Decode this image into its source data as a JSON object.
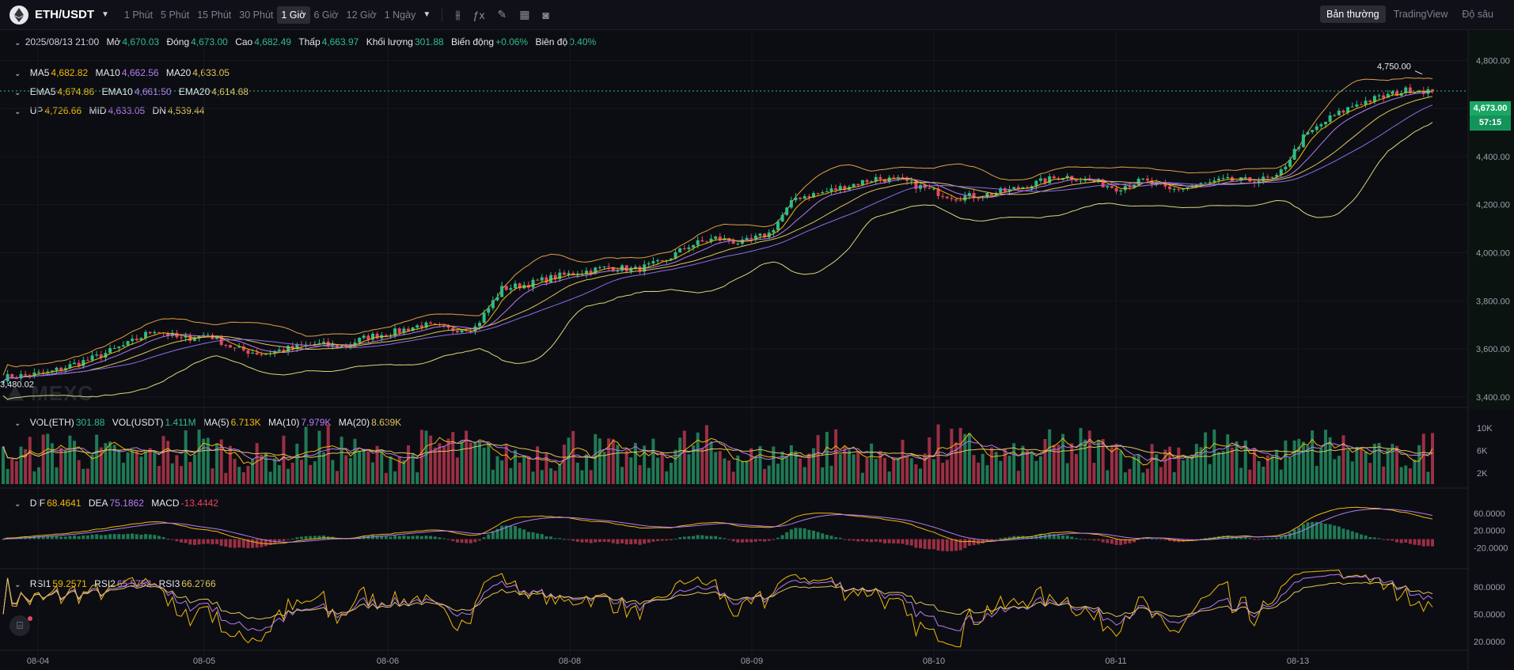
{
  "header": {
    "pair": "ETH/USDT",
    "intervals": [
      "1 Phút",
      "5 Phút",
      "15 Phút",
      "30 Phút",
      "1 Giờ",
      "6 Giờ",
      "12 Giờ",
      "1 Ngày"
    ],
    "active_interval": "1 Giờ",
    "views": [
      "Bản thường",
      "TradingView",
      "Độ sâu"
    ],
    "active_view": "Bản thường"
  },
  "ohlc": {
    "date": "2025/08/13 21:00",
    "open_label": "Mở",
    "open": "4,670.03",
    "close_label": "Đóng",
    "close": "4,673.00",
    "high_label": "Cao",
    "high": "4,682.49",
    "low_label": "Thấp",
    "low": "4,663.97",
    "volume_label": "Khối lượng",
    "volume": "301.88",
    "change_label": "Biến động",
    "change": "+0.06%",
    "amplitude_label": "Biên độ",
    "amplitude": "0.40%"
  },
  "ma": {
    "ma5_label": "MA5",
    "ma5": "4,682.82",
    "ma10_label": "MA10",
    "ma10": "4,662.56",
    "ma20_label": "MA20",
    "ma20": "4,633.05"
  },
  "ema": {
    "ema5_label": "EMA5",
    "ema5": "4,674.86",
    "ema10_label": "EMA10",
    "ema10": "4,661.50",
    "ema20_label": "EMA20",
    "ema20": "4,614.68"
  },
  "boll": {
    "up_label": "UP",
    "up": "4,726.66",
    "mid_label": "MID",
    "mid": "4,633.05",
    "dn_label": "DN",
    "dn": "4,539.44"
  },
  "vol": {
    "eth_label": "VOL(ETH)",
    "eth": "301.88",
    "usdt_label": "VOL(USDT)",
    "usdt": "1.411M",
    "ma5_label": "MA(5)",
    "ma5": "6.713K",
    "ma10_label": "MA(10)",
    "ma10": "7.979K",
    "ma20_label": "MA(20)",
    "ma20": "8.639K"
  },
  "macd": {
    "dif_label": "DIF",
    "dif": "68.4641",
    "dea_label": "DEA",
    "dea": "75.1862",
    "macd_label": "MACD",
    "macd": "-13.4442"
  },
  "rsi": {
    "rsi1_label": "RSI1",
    "rsi1": "59.2571",
    "rsi2_label": "RSI2",
    "rsi2": "65.5752",
    "rsi3_label": "RSI3",
    "rsi3": "66.2766"
  },
  "markers": {
    "high": "4,750.00",
    "low": "3,480.02",
    "last_price": "4,673.00",
    "countdown": "57:15"
  },
  "watermark": "MEXC",
  "colors": {
    "up": "#2ebd85",
    "down": "#e84660",
    "ma5": "#f0b90b",
    "ma10": "#b57cf2",
    "ma20": "#e0c35a",
    "bg": "#0c0d12"
  },
  "chart_data": {
    "type": "candlestick",
    "x_ticks": [
      "08-04",
      "08-05",
      "08-06",
      "08-08",
      "08-09",
      "08-10",
      "08-11",
      "08-13"
    ],
    "price_axis": {
      "ticks": [
        "4,800.00",
        "4,600.00",
        "4,400.00",
        "4,200.00",
        "4,000.00",
        "3,800.00",
        "3,600.00",
        "3,400.00"
      ],
      "range": [
        3340,
        4920
      ]
    },
    "close_anchors": [
      [
        0,
        3480
      ],
      [
        10,
        3500
      ],
      [
        20,
        3560
      ],
      [
        28,
        3620
      ],
      [
        34,
        3680
      ],
      [
        40,
        3640
      ],
      [
        46,
        3660
      ],
      [
        52,
        3600
      ],
      [
        58,
        3580
      ],
      [
        64,
        3600
      ],
      [
        70,
        3620
      ],
      [
        76,
        3610
      ],
      [
        82,
        3650
      ],
      [
        88,
        3670
      ],
      [
        94,
        3700
      ],
      [
        100,
        3680
      ],
      [
        106,
        3690
      ],
      [
        112,
        3850
      ],
      [
        118,
        3870
      ],
      [
        124,
        3900
      ],
      [
        130,
        3920
      ],
      [
        136,
        3940
      ],
      [
        142,
        3930
      ],
      [
        148,
        3960
      ],
      [
        154,
        4030
      ],
      [
        160,
        4060
      ],
      [
        166,
        4040
      ],
      [
        172,
        4080
      ],
      [
        178,
        4230
      ],
      [
        184,
        4250
      ],
      [
        190,
        4280
      ],
      [
        196,
        4310
      ],
      [
        202,
        4300
      ],
      [
        208,
        4260
      ],
      [
        214,
        4230
      ],
      [
        220,
        4240
      ],
      [
        226,
        4260
      ],
      [
        232,
        4290
      ],
      [
        238,
        4320
      ],
      [
        244,
        4300
      ],
      [
        250,
        4270
      ],
      [
        256,
        4300
      ],
      [
        262,
        4260
      ],
      [
        268,
        4280
      ],
      [
        274,
        4300
      ],
      [
        280,
        4300
      ],
      [
        286,
        4310
      ],
      [
        292,
        4480
      ],
      [
        298,
        4560
      ],
      [
        304,
        4620
      ],
      [
        310,
        4650
      ],
      [
        316,
        4680
      ],
      [
        321,
        4673
      ]
    ],
    "volume_axis": {
      "ticks": [
        "10K",
        "6K",
        "2K"
      ]
    },
    "macd_axis": {
      "ticks": [
        "60.0000",
        "20.0000",
        "-20.0000"
      ]
    },
    "rsi_axis": {
      "ticks": [
        "80.0000",
        "50.0000",
        "20.0000"
      ]
    }
  }
}
